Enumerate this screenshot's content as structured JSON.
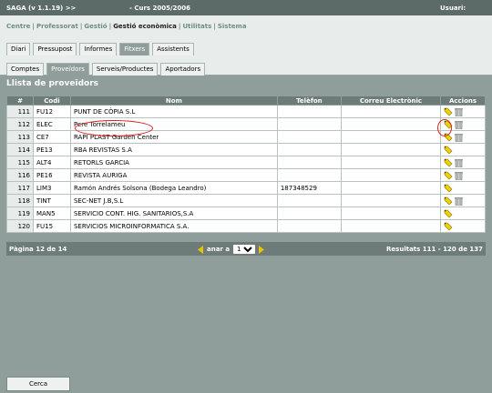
{
  "topbar": {
    "app_title": "SAGA (v 1.1.19) >>",
    "course": "- Curs 2005/2006",
    "user_label": "Usuari:"
  },
  "menu": {
    "items": [
      "Centre",
      "Professorat",
      "Gestió",
      "Gestió econòmica",
      "Utilitats",
      "Sistema"
    ],
    "active": "Gestió econòmica"
  },
  "tabs_level1": [
    {
      "label": "Diari",
      "active": false
    },
    {
      "label": "Pressupost",
      "active": false
    },
    {
      "label": "Informes",
      "active": false
    },
    {
      "label": "Fitxers",
      "active": true
    },
    {
      "label": "Assistents",
      "active": false
    }
  ],
  "tabs_level2": [
    {
      "label": "Comptes",
      "active": false
    },
    {
      "label": "Proveïdors",
      "active": true
    },
    {
      "label": "Serveis/Productes",
      "active": false
    },
    {
      "label": "Aportadors",
      "active": false
    }
  ],
  "page_title": "Llista de proveïdors",
  "table": {
    "headers": [
      "#",
      "Codi",
      "Nom",
      "Telèfon",
      "Correu Electrònic",
      "Accions"
    ],
    "rows": [
      {
        "num": "111",
        "code": "FU12",
        "name": "PUNT DE CÒPIA S.L",
        "phone": "",
        "email": "",
        "delete": true
      },
      {
        "num": "112",
        "code": "ELEC",
        "name": "Pere Torrelameu",
        "phone": "",
        "email": "",
        "delete": true
      },
      {
        "num": "113",
        "code": "CE7",
        "name": "RAPI PLAST Garden Center",
        "phone": "",
        "email": "",
        "delete": true
      },
      {
        "num": "114",
        "code": "PE13",
        "name": "RBA REVISTAS S.A",
        "phone": "",
        "email": "",
        "delete": false
      },
      {
        "num": "115",
        "code": "ALT4",
        "name": "RETORLS GARCIA",
        "phone": "",
        "email": "",
        "delete": true
      },
      {
        "num": "116",
        "code": "PE16",
        "name": "REVISTA AURIGA",
        "phone": "",
        "email": "",
        "delete": true
      },
      {
        "num": "117",
        "code": "LIM3",
        "name": "Ramón Andrés Solsona (Bodega Leandro)",
        "phone": "187348529",
        "email": "",
        "delete": false
      },
      {
        "num": "118",
        "code": "TINT",
        "name": "SEC-NET J.B,S.L",
        "phone": "",
        "email": "",
        "delete": true
      },
      {
        "num": "119",
        "code": "MAN5",
        "name": "SERVICIO CONT. HIG. SANITARIOS,S.A",
        "phone": "",
        "email": "",
        "delete": false
      },
      {
        "num": "120",
        "code": "FU15",
        "name": "SERVICIOS MICROINFORMATICA S.A.",
        "phone": "",
        "email": "",
        "delete": false
      }
    ]
  },
  "footer": {
    "page_label": "Pàgina 12 de 14",
    "goto_label": "anar a",
    "goto_value": "12",
    "results_label": "Resultats 111 - 120 de 137"
  },
  "close_button": "Cerca",
  "icons": {
    "edit": "edit-pencil-icon",
    "delete": "trash-icon",
    "prev": "arrow-left-icon",
    "next": "arrow-right-icon"
  },
  "colors": {
    "header_bg": "#5c6b67",
    "menu_link": "#6f8d87",
    "highlight_ring": "#d22",
    "arrow": "#e8c400"
  }
}
